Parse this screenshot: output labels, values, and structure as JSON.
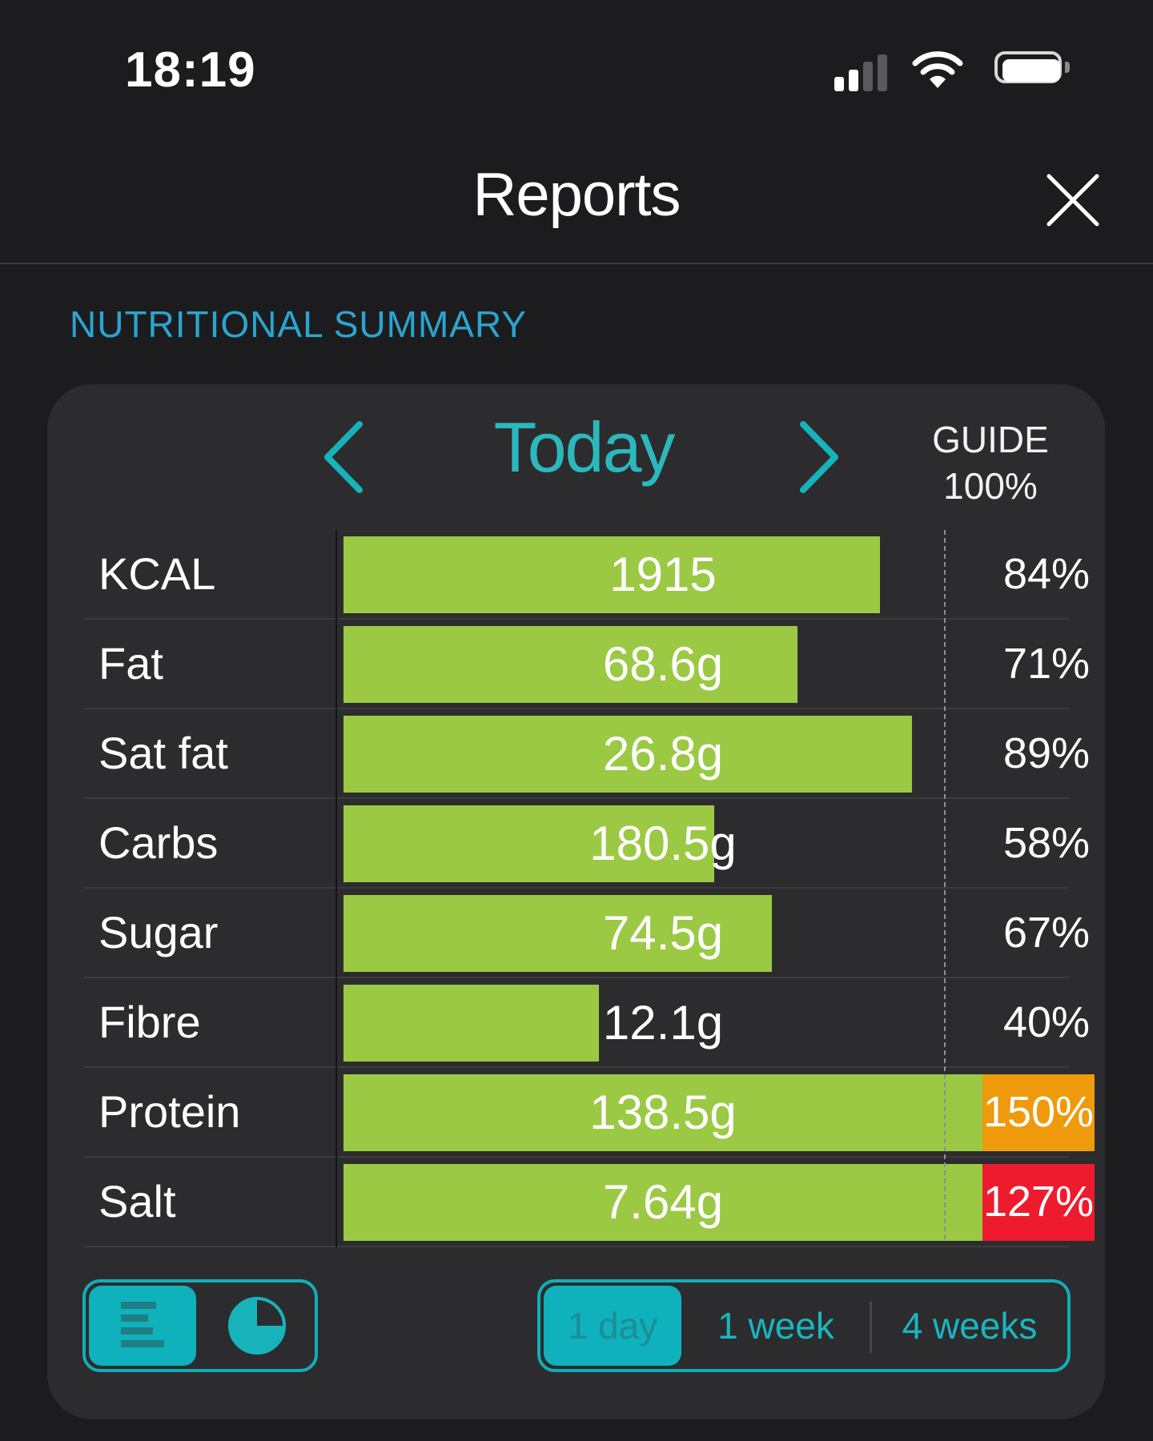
{
  "status_bar": {
    "time": "18:19"
  },
  "header": {
    "title": "Reports"
  },
  "section_label": "NUTRITIONAL SUMMARY",
  "period": {
    "label": "Today"
  },
  "guide": {
    "line1": "GUIDE",
    "line2": "100%"
  },
  "colors": {
    "accent": "#11aeb8",
    "bar": "#9bc944",
    "warning": "#ef9a0c",
    "danger": "#ee1b2e",
    "section": "#2ba5cf"
  },
  "nutrients": [
    {
      "name": "KCAL",
      "value": "1915",
      "percent": "84%",
      "fill_percent": 84,
      "status": "normal"
    },
    {
      "name": "Fat",
      "value": "68.6g",
      "percent": "71%",
      "fill_percent": 71,
      "status": "normal"
    },
    {
      "name": "Sat fat",
      "value": "26.8g",
      "percent": "89%",
      "fill_percent": 89,
      "status": "normal"
    },
    {
      "name": "Carbs",
      "value": "180.5g",
      "percent": "58%",
      "fill_percent": 58,
      "status": "normal"
    },
    {
      "name": "Sugar",
      "value": "74.5g",
      "percent": "67%",
      "fill_percent": 67,
      "status": "normal"
    },
    {
      "name": "Fibre",
      "value": "12.1g",
      "percent": "40%",
      "fill_percent": 40,
      "status": "normal"
    },
    {
      "name": "Protein",
      "value": "138.5g",
      "percent": "150%",
      "fill_percent": 100,
      "status": "warning"
    },
    {
      "name": "Salt",
      "value": "7.64g",
      "percent": "127%",
      "fill_percent": 100,
      "status": "danger"
    }
  ],
  "view_toggle": {
    "options": [
      "bar-chart-view-icon",
      "pie-chart-view-icon"
    ],
    "selected": 0
  },
  "range_toggle": {
    "options": [
      "1 day",
      "1 week",
      "4 weeks"
    ],
    "selected": 0
  }
}
